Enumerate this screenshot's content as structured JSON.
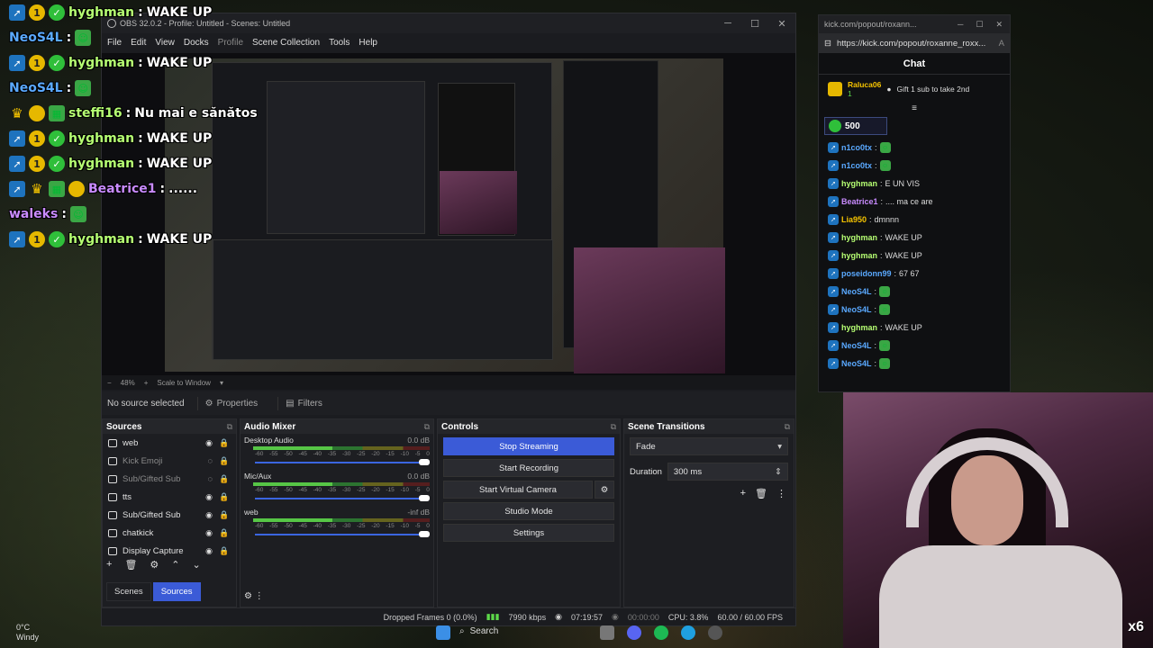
{
  "overlay_chat": [
    {
      "user": "hyghman",
      "msg": "WAKE UP",
      "color": "green",
      "badges": [
        "mod",
        "one",
        "verified"
      ]
    },
    {
      "user": "NeoS4L",
      "msg": "",
      "color": "blue",
      "badges": [],
      "emote": true
    },
    {
      "user": "hyghman",
      "msg": "WAKE UP",
      "color": "green",
      "badges": [
        "mod",
        "one",
        "verified"
      ]
    },
    {
      "user": "NeoS4L",
      "msg": "",
      "color": "blue",
      "badges": [],
      "emote": true
    },
    {
      "user": "steffi16",
      "msg": "Nu mai e sănătos",
      "color": "green",
      "badges": [
        "crown",
        "avatar",
        "sub"
      ]
    },
    {
      "user": "hyghman",
      "msg": "WAKE UP",
      "color": "green",
      "badges": [
        "mod",
        "one",
        "verified"
      ]
    },
    {
      "user": "hyghman",
      "msg": "WAKE UP",
      "color": "green",
      "badges": [
        "mod",
        "one",
        "verified"
      ]
    },
    {
      "user": "Beatrice1",
      "msg": "......",
      "color": "purple",
      "badges": [
        "mod",
        "crown",
        "sub",
        "avatar"
      ]
    },
    {
      "user": "waleks",
      "msg": "",
      "color": "purple",
      "badges": [],
      "emote": true
    },
    {
      "user": "hyghman",
      "msg": "WAKE UP",
      "color": "green",
      "badges": [
        "mod",
        "one",
        "verified"
      ]
    }
  ],
  "obs": {
    "title": "OBS 32.0.2 - Profile: Untitled - Scenes: Untitled",
    "menu": [
      "File",
      "Edit",
      "View",
      "Docks",
      "Profile",
      "Scene Collection",
      "Tools",
      "Help"
    ],
    "zoom": "48%",
    "scale_mode": "Scale to Window",
    "no_source": "No source selected",
    "properties": "Properties",
    "filters": "Filters",
    "sources_title": "Sources",
    "sources": [
      {
        "name": "web",
        "dim": false,
        "icon": "browser-icon"
      },
      {
        "name": "Kick Emoji",
        "dim": true,
        "icon": "browser-icon"
      },
      {
        "name": "Sub/Gifted Sub",
        "dim": true,
        "icon": "browser-icon"
      },
      {
        "name": "tts",
        "dim": false,
        "icon": "browser-icon"
      },
      {
        "name": "Sub/Gifted Sub",
        "dim": false,
        "icon": "browser-icon"
      },
      {
        "name": "chatkick",
        "dim": false,
        "icon": "browser-icon"
      },
      {
        "name": "Display Capture",
        "dim": false,
        "icon": "monitor-icon"
      }
    ],
    "tabs": {
      "scenes": "Scenes",
      "sources": "Sources"
    },
    "mixer_title": "Audio Mixer",
    "mixer": [
      {
        "name": "Desktop Audio",
        "db": "0.0 dB"
      },
      {
        "name": "Mic/Aux",
        "db": "0.0 dB"
      },
      {
        "name": "web",
        "db": "-inf dB"
      }
    ],
    "scale_ticks": [
      "-60",
      "-55",
      "-50",
      "-45",
      "-40",
      "-35",
      "-30",
      "-25",
      "-20",
      "-15",
      "-10",
      "-5",
      "0"
    ],
    "controls_title": "Controls",
    "controls": {
      "stop_streaming": "Stop Streaming",
      "start_recording": "Start Recording",
      "start_virtual_camera": "Start Virtual Camera",
      "studio_mode": "Studio Mode",
      "settings": "Settings"
    },
    "transitions_title": "Scene Transitions",
    "transition": "Fade",
    "duration_label": "Duration",
    "duration_value": "300 ms",
    "status": {
      "dropped": "Dropped Frames 0 (0.0%)",
      "bitrate": "7990 kbps",
      "live_time": "07:19:57",
      "rec_time": "00:00:00",
      "cpu": "CPU: 3.8%",
      "fps": "60.00 / 60.00 FPS"
    }
  },
  "kick": {
    "window_title": "kick.com/popout/roxann...",
    "url": "https://kick.com/popout/roxanne_roxx...",
    "chat_title": "Chat",
    "pinned_user": "Raluca06",
    "pinned_count": "1",
    "pinned_text": "Gift 1 sub to take 2nd",
    "gift_count": "500",
    "messages": [
      {
        "user": "n1co0tx",
        "msg": "",
        "color": "#5aa9ff"
      },
      {
        "user": "n1co0tx",
        "msg": "",
        "color": "#5aa9ff"
      },
      {
        "user": "hyghman",
        "msg": "E UN VIS",
        "color": "#b6ff73"
      },
      {
        "user": "Beatrice1",
        "msg": ".... ma ce are",
        "color": "#c98bff"
      },
      {
        "user": "Lia950",
        "msg": "dmnnn",
        "color": "#f6c400"
      },
      {
        "user": "hyghman",
        "msg": "WAKE UP",
        "color": "#b6ff73"
      },
      {
        "user": "hyghman",
        "msg": "WAKE UP",
        "color": "#b6ff73"
      },
      {
        "user": "poseidonn99",
        "msg": "67 67",
        "color": "#5aa9ff"
      },
      {
        "user": "NeoS4L",
        "msg": "",
        "color": "#5aa9ff"
      },
      {
        "user": "NeoS4L",
        "msg": "",
        "color": "#5aa9ff"
      },
      {
        "user": "hyghman",
        "msg": "WAKE UP",
        "color": "#b6ff73"
      },
      {
        "user": "NeoS4L",
        "msg": "",
        "color": "#5aa9ff"
      },
      {
        "user": "NeoS4L",
        "msg": "",
        "color": "#5aa9ff"
      }
    ]
  },
  "webcam": {
    "multiplier": "x6"
  },
  "weather": {
    "temp": "0°C",
    "cond": "Windy"
  },
  "taskbar": {
    "search": "Search"
  },
  "colors": {
    "accent": "#3b5bd7",
    "meter_green": "#5dd94a"
  }
}
